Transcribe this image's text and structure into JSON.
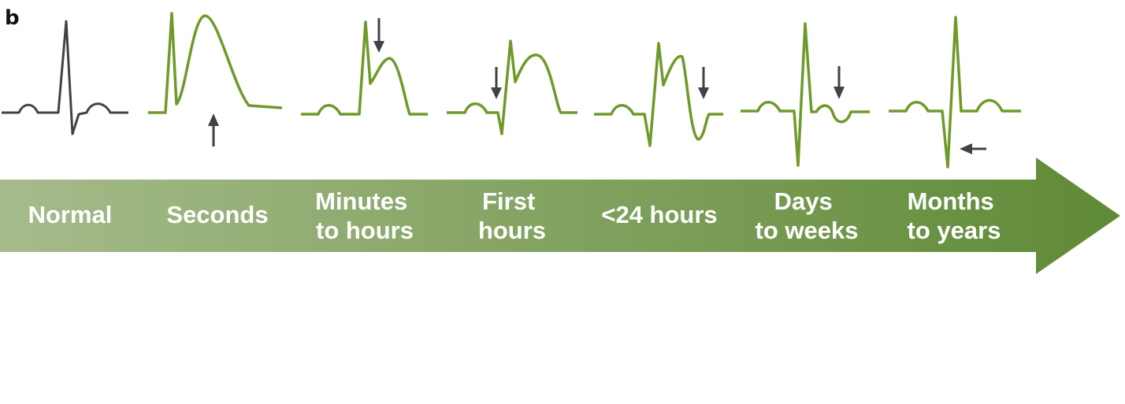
{
  "panel_letter": "b",
  "colors": {
    "normal_trace": "#3f4347",
    "ecg_trace": "#6f9a2a",
    "arrow_marker": "#3f4347",
    "timeline_left": "#a6bb8b",
    "timeline_right": "#5f8a36",
    "label_text": "#ffffff"
  },
  "timeline": {
    "stages": [
      {
        "id": "normal",
        "lines": [
          "Normal"
        ]
      },
      {
        "id": "seconds",
        "lines": [
          "Seconds"
        ]
      },
      {
        "id": "minutes",
        "lines": [
          "Minutes",
          "to hours"
        ]
      },
      {
        "id": "first",
        "lines": [
          "First",
          "hours"
        ]
      },
      {
        "id": "lt24",
        "lines": [
          "<24 hours"
        ]
      },
      {
        "id": "days",
        "lines": [
          "Days",
          "to weeks"
        ]
      },
      {
        "id": "months",
        "lines": [
          "Months",
          "to years"
        ]
      }
    ]
  },
  "waveforms": [
    {
      "stage": "normal",
      "description_icon": "normal-ecg-trace"
    },
    {
      "stage": "seconds",
      "description_icon": "hyperacute-t-wave-trace",
      "marker": "up-arrow-icon"
    },
    {
      "stage": "minutes",
      "description_icon": "st-elevation-trace",
      "marker": "down-arrow-icon"
    },
    {
      "stage": "first",
      "description_icon": "q-wave-onset-trace",
      "marker": "down-arrow-icon"
    },
    {
      "stage": "lt24",
      "description_icon": "t-wave-inversion-trace",
      "marker": "down-arrow-icon"
    },
    {
      "stage": "days",
      "description_icon": "inverted-t-wave-trace",
      "marker": "down-arrow-icon"
    },
    {
      "stage": "months",
      "description_icon": "persistent-q-wave-trace",
      "marker": "left-arrow-icon"
    }
  ]
}
